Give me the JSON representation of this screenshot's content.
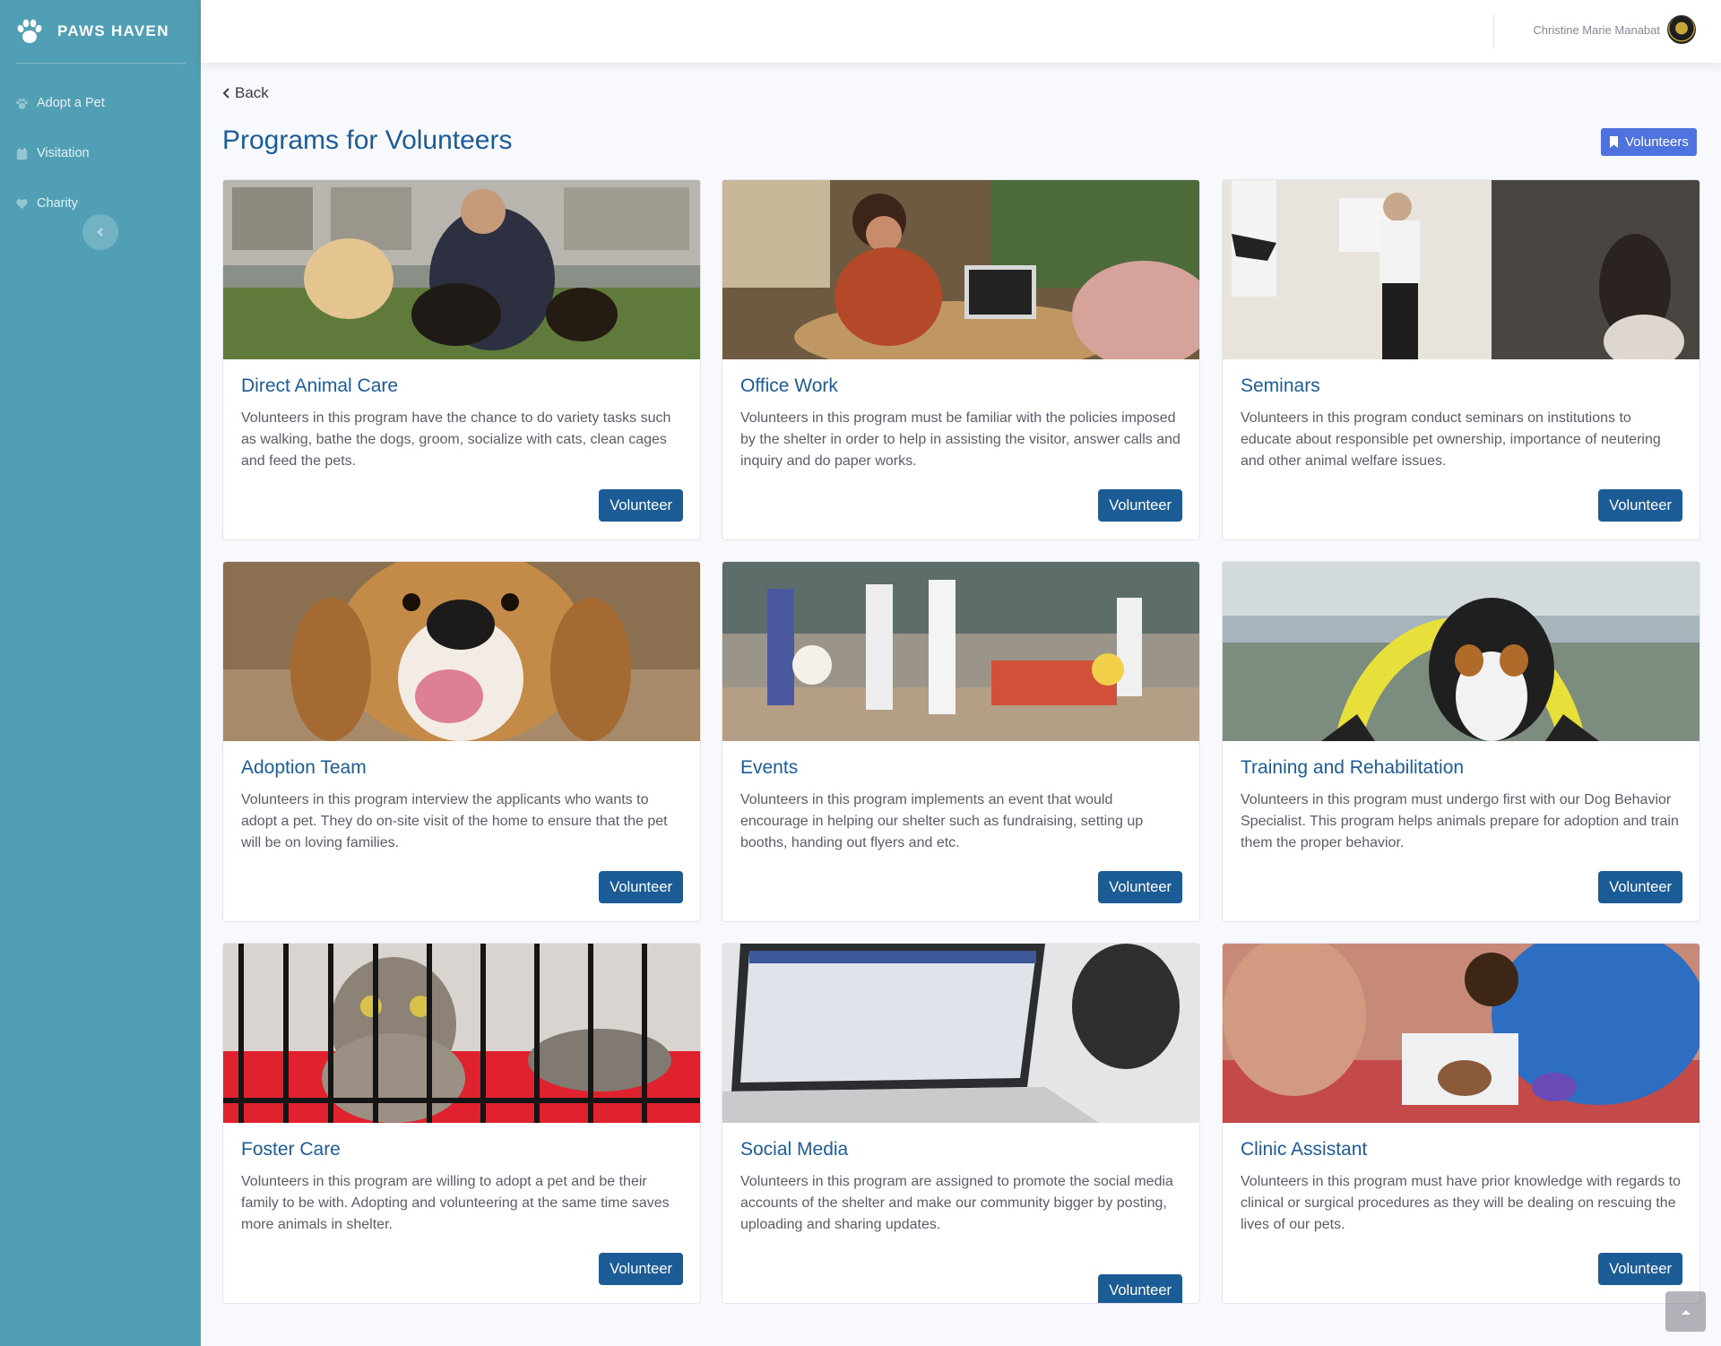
{
  "brand": {
    "name": "PAWS HAVEN"
  },
  "sidebar": {
    "items": [
      {
        "label": "Adopt a Pet",
        "icon": "paw-icon"
      },
      {
        "label": "Visitation",
        "icon": "calendar-icon"
      },
      {
        "label": "Charity",
        "icon": "heart-icon"
      }
    ]
  },
  "topbar": {
    "user_name": "Christine Marie Manabat"
  },
  "header": {
    "back_label": "Back",
    "title": "Programs for Volunteers",
    "badge_label": "Volunteers"
  },
  "cards": [
    {
      "title": "Direct Animal Care",
      "text": "Volunteers in this program have the chance to do variety tasks such as walking, bathe the dogs, groom, socialize with cats, clean cages and feed the pets.",
      "button": "Volunteer",
      "image": "woman-with-puppies-photo"
    },
    {
      "title": "Office Work",
      "text": "Volunteers in this program must be familiar with the policies imposed by the shelter in order to help in assisting the visitor, answer calls and inquiry and do paper works.",
      "button": "Volunteer",
      "image": "office-meeting-photo"
    },
    {
      "title": "Seminars",
      "text": "Volunteers in this program conduct seminars on institutions to educate about responsible pet ownership, importance of neutering and other animal welfare issues.",
      "button": "Volunteer",
      "image": "seminar-presenter-photo"
    },
    {
      "title": "Adoption Team",
      "text": "Volunteers in this program interview the applicants who wants to adopt a pet. They do on-site visit of the home to ensure that the pet will be on loving families.",
      "button": "Volunteer",
      "image": "smiling-beagle-photo"
    },
    {
      "title": "Events",
      "text": "Volunteers in this program implements an event that would encourage in helping our shelter such as fundraising, setting up booths, handing out flyers and etc.",
      "button": "Volunteer",
      "image": "pet-event-crowd-photo"
    },
    {
      "title": "Training and Rehabilitation",
      "text": "Volunteers in this program must undergo first with our Dog Behavior Specialist. This program helps animals prepare for adoption and train them the proper behavior.",
      "button": "Volunteer",
      "image": "dog-agility-ring-photo"
    },
    {
      "title": "Foster Care",
      "text": "Volunteers in this program are willing to adopt a pet and be their family to be with. Adopting and volunteering at the same time saves more animals in shelter.",
      "button": "Volunteer",
      "image": "kitten-in-cage-photo"
    },
    {
      "title": "Social Media",
      "text": "Volunteers in this program are assigned to promote the social media accounts of the shelter and make our community bigger by posting, uploading and sharing updates.",
      "button": "Volunteer",
      "image": "laptop-social-media-photo"
    },
    {
      "title": "Clinic Assistant",
      "text": "Volunteers in this program must have prior knowledge with regards to clinical or surgical procedures as they will be dealing on rescuing the lives of our pets.",
      "button": "Volunteer",
      "image": "clinic-procedure-photo"
    }
  ],
  "colors": {
    "sidebar_bg": "#519fb4",
    "primary": "#1c5c96",
    "badge": "#4e73df"
  }
}
